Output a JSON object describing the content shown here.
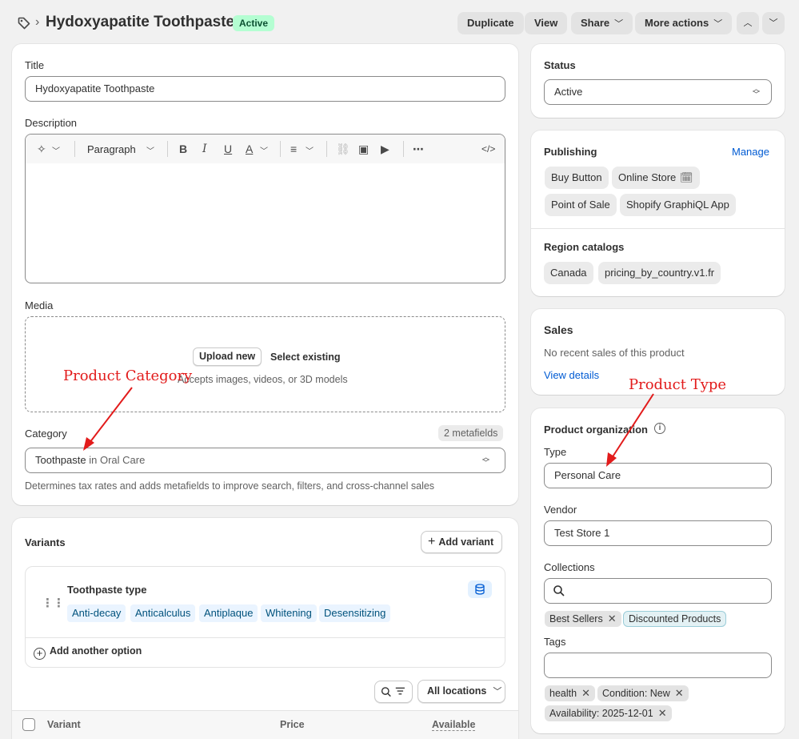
{
  "header": {
    "title": "Hydoxyapatite Toothpaste",
    "status": "Active",
    "duplicate": "Duplicate",
    "view": "View",
    "share": "Share",
    "more_actions": "More actions"
  },
  "main": {
    "title_label": "Title",
    "title_value": "Hydoxyapatite Toothpaste",
    "description_label": "Description",
    "paragraph": "Paragraph",
    "media_label": "Media",
    "upload_new": "Upload new",
    "select_existing": "Select existing",
    "media_hint": "Accepts images, videos, or 3D models",
    "category_label": "Category",
    "metafields": "2 metafields",
    "category_value": "Toothpaste",
    "category_suffix": "in Oral Care",
    "category_help": "Determines tax rates and adds metafields to improve search, filters, and cross-channel sales"
  },
  "variants": {
    "heading": "Variants",
    "add_variant": "Add variant",
    "option_name": "Toothpaste type",
    "option_values": [
      "Anti-decay",
      "Anticalculus",
      "Antiplaque",
      "Whitening",
      "Desensitizing"
    ],
    "add_another_option": "Add another option",
    "all_locations": "All locations",
    "columns": [
      "Variant",
      "Price",
      "Available"
    ]
  },
  "sidebar": {
    "status_label": "Status",
    "status_value": "Active",
    "publishing_label": "Publishing",
    "manage": "Manage",
    "channels": [
      "Buy Button",
      "Online Store",
      "Point of Sale",
      "Shopify GraphiQL App"
    ],
    "region_catalogs_label": "Region catalogs",
    "catalogs": [
      "Canada",
      "pricing_by_country.v1.fr"
    ],
    "sales_label": "Sales",
    "sales_text": "No recent sales of this product",
    "view_details": "View details",
    "org_label": "Product organization",
    "type_label": "Type",
    "type_value": "Personal Care",
    "vendor_label": "Vendor",
    "vendor_value": "Test Store 1",
    "collections_label": "Collections",
    "collections": [
      "Best Sellers",
      "Discounted Products"
    ],
    "tags_label": "Tags",
    "tags": [
      "health",
      "Condition: New",
      "Availability: 2025-12-01"
    ]
  },
  "annotations": {
    "product_category": "Product Category",
    "product_type": "Product Type"
  },
  "colors": {
    "accent": "#005bd3",
    "annotation": "#e21b1b",
    "status_bg": "#b4fed2"
  }
}
